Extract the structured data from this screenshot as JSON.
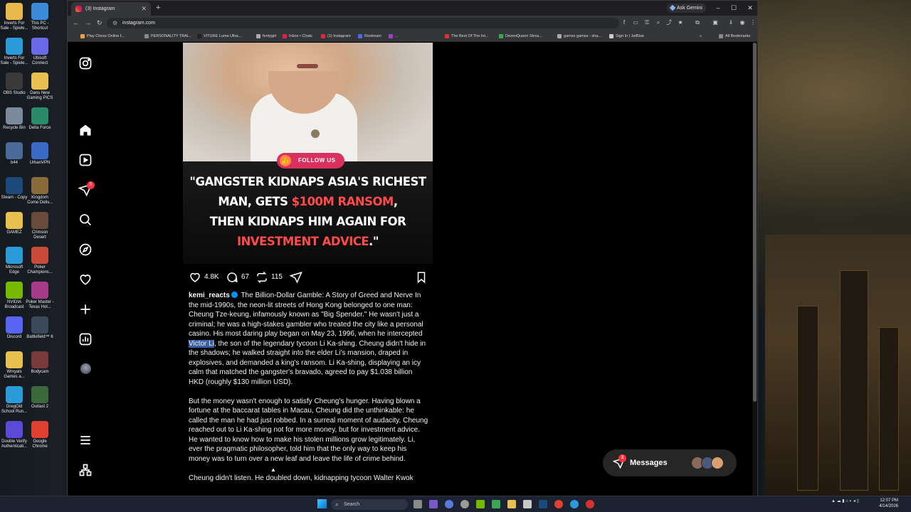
{
  "desktop": {
    "icons": [
      {
        "label": "Inverts For Sale - Spiele..."
      },
      {
        "label": "This PC - Shortcut"
      },
      {
        "label": "Inverts For Sale - Spiele..."
      },
      {
        "label": "Ubisoft Connect"
      },
      {
        "label": "OBS Studio"
      },
      {
        "label": "Dans New Gaming PICS"
      },
      {
        "label": "Recycle Bin"
      },
      {
        "label": "Delta Force"
      },
      {
        "label": "b44"
      },
      {
        "label": "UrbanVPN"
      },
      {
        "label": "Steam - Copy"
      },
      {
        "label": "Kingdom Come Deliv..."
      },
      {
        "label": "GAMEZ"
      },
      {
        "label": "Crimson Desert"
      },
      {
        "label": "Microsoft Edge"
      },
      {
        "label": "Poker Champions..."
      },
      {
        "label": "NVIDIA Broadcast"
      },
      {
        "label": "Poker Master - Texas Hol..."
      },
      {
        "label": "Discord"
      },
      {
        "label": "Battlefield™ 6"
      },
      {
        "label": "Wrxyals Games a..."
      },
      {
        "label": "Bodycam"
      },
      {
        "label": "GregOld School Run..."
      },
      {
        "label": "Outlast 2"
      },
      {
        "label": "Double Verify Authenticati..."
      },
      {
        "label": "Google Chrome"
      }
    ]
  },
  "browser": {
    "tab_title": "(3) Instagram",
    "new_tab_symbol": "+",
    "ask_gemini": "Ask Gemini",
    "url": "instagram.com",
    "bookmarks": [
      {
        "label": "Play Chess Online f..."
      },
      {
        "label": "PERSONALITY TRAI..."
      },
      {
        "label": "VITURE Luma Ultra..."
      },
      {
        "label": "fentygirl"
      },
      {
        "label": "Inbox • Chats"
      },
      {
        "label": "(1) Instagram"
      },
      {
        "label": "Restream"
      },
      {
        "label": "..."
      },
      {
        "label": "The Best Of The Int..."
      },
      {
        "label": "DezenQueen Strea..."
      },
      {
        "label": "games games - sha..."
      },
      {
        "label": "Sign In | JetBlue"
      }
    ],
    "all_bookmarks": "All Bookmarks"
  },
  "instagram": {
    "notification_count": "5",
    "post": {
      "follow_button": "FOLLOW US",
      "headline": {
        "line1": "\"GANGSTER KIDNAPS ASIA'S RICHEST",
        "line2_a": "MAN, GETS ",
        "line2_b": "$100M RANSOM",
        "line2_c": ",",
        "line3": "THEN KIDNAPS HIM AGAIN FOR",
        "line4_a": "INVESTMENT ADVICE",
        "line4_b": ".\""
      },
      "likes": "4.8K",
      "comments": "67",
      "reposts": "115",
      "caption": {
        "username": "kemi_reacts",
        "p1_before": "The Billion-Dollar Gamble: A Story of Greed and Nerve In the mid-1990s, the neon-lit streets of Hong Kong belonged to one man: Cheung Tze-keung, infamously known as \"Big Spender.\" He wasn't just a criminal; he was a high-stakes gambler who treated the city like a personal casino. His most daring play began on May 23, 1996, when he intercepted ",
        "p1_selected": "Victor Li",
        "p1_after": ", the son of the legendary tycoon Li Ka-shing. Cheung didn't hide in the shadows; he walked straight into the elder Li's mansion, draped in explosives, and demanded a king's ransom. Li Ka-shing, displaying an icy calm that matched the gangster's bravado, agreed to pay $1.038 billion HKD (roughly $130 million USD).",
        "p2": "But the money wasn't enough to satisfy Cheung's hunger. Having blown a fortune at the baccarat tables in Macau, Cheung did the unthinkable: he called the man he had just robbed. In a surreal moment of audacity, Cheung reached out to Li Ka-shing not for more money, but for investment advice. He wanted to know how to make his stolen millions grow legitimately. Li, ever the pragmatic philosopher, told him that the only way to keep his money was to turn over a new leaf and leave the life of crime behind.",
        "p3": "Cheung didn't listen. He doubled down, kidnapping tycoon Walter Kwok"
      }
    },
    "messages": {
      "label": "Messages",
      "badge": "3"
    }
  },
  "taskbar": {
    "search_placeholder": "Search",
    "time": "12:07 PM",
    "date": "4/14/2026"
  },
  "colors": {
    "accent_red": "#ff4a4a",
    "ig_badge": "#ff3040",
    "follow_pink": "#d93060",
    "selection": "#3a5fa8"
  }
}
